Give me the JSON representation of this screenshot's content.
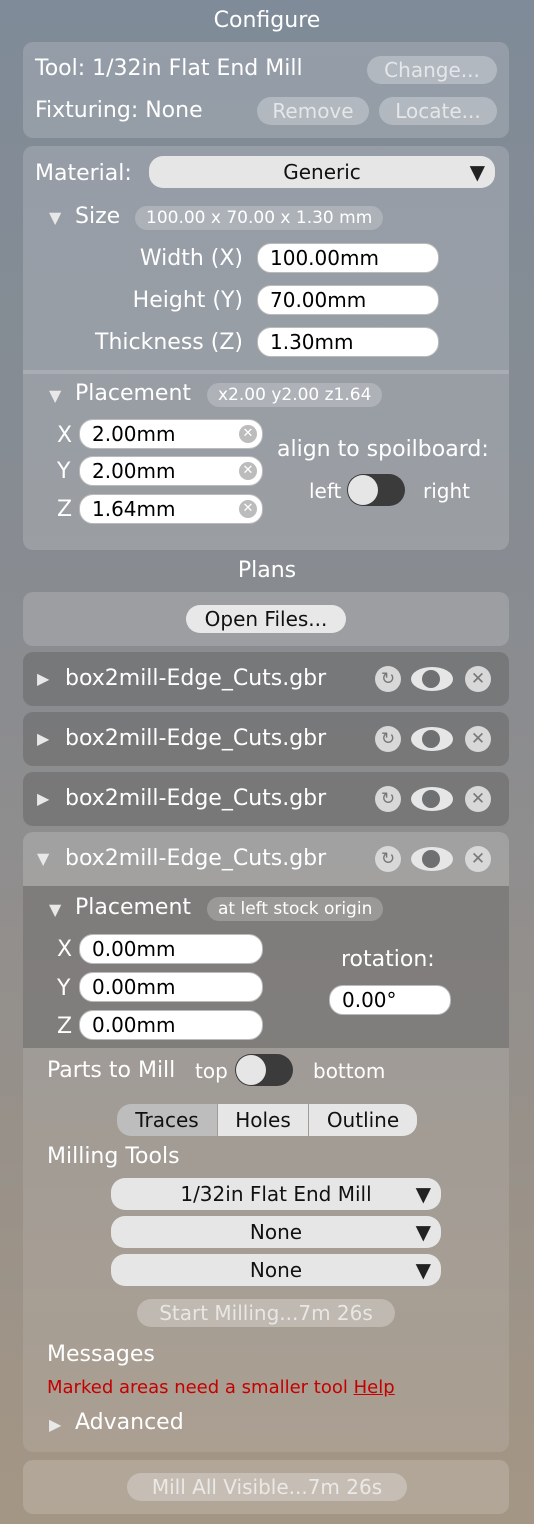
{
  "configure": {
    "title": "Configure",
    "tool_label": "Tool: 1/32in Flat End Mill",
    "change_button": "Change...",
    "fixturing_label": "Fixturing: None",
    "remove_button": "Remove",
    "locate_button": "Locate..."
  },
  "material": {
    "label": "Material:",
    "value": "Generic",
    "size_label": "Size",
    "size_summary": "100.00 x 70.00 x 1.30 mm",
    "width_label": "Width (X)",
    "width_value": "100.00mm",
    "height_label": "Height (Y)",
    "height_value": "70.00mm",
    "thickness_label": "Thickness (Z)",
    "thickness_value": "1.30mm"
  },
  "stock_placement": {
    "label": "Placement",
    "summary": "x2.00 y2.00 z1.64",
    "x_label": "X",
    "x_value": "2.00mm",
    "y_label": "Y",
    "y_value": "2.00mm",
    "z_label": "Z",
    "z_value": "1.64mm",
    "align_label": "align to spoilboard:",
    "align_left": "left",
    "align_right": "right",
    "align_state": "left"
  },
  "plans": {
    "title": "Plans",
    "open_files_button": "Open Files...",
    "files": [
      {
        "name": "box2mill-Edge_Cuts.gbr",
        "expanded": false
      },
      {
        "name": "box2mill-Edge_Cuts.gbr",
        "expanded": false
      },
      {
        "name": "box2mill-Edge_Cuts.gbr",
        "expanded": false
      },
      {
        "name": "box2mill-Edge_Cuts.gbr",
        "expanded": true
      }
    ]
  },
  "file_detail": {
    "placement_label": "Placement",
    "placement_summary": "at left stock origin",
    "x_label": "X",
    "x_value": "0.00mm",
    "y_label": "Y",
    "y_value": "0.00mm",
    "z_label": "Z",
    "z_value": "0.00mm",
    "rotation_label": "rotation:",
    "rotation_value": "0.00°",
    "parts_label": "Parts to Mill",
    "parts_top": "top",
    "parts_bottom": "bottom",
    "parts_state": "top",
    "tabs": [
      "Traces",
      "Holes",
      "Outline"
    ],
    "selected_tab": "Traces",
    "milling_tools_label": "Milling Tools",
    "tool_1": "1/32in Flat End Mill",
    "tool_2": "None",
    "tool_3": "None",
    "start_button": "Start Milling...7m 26s",
    "messages_label": "Messages",
    "message_text": "Marked areas need a smaller tool",
    "help_link": "Help",
    "advanced_label": "Advanced"
  },
  "footer": {
    "mill_all_button": "Mill All Visible...7m 26s"
  },
  "colors": {
    "error_text": "#c40000",
    "toggle_track": "#3b3b3b"
  }
}
